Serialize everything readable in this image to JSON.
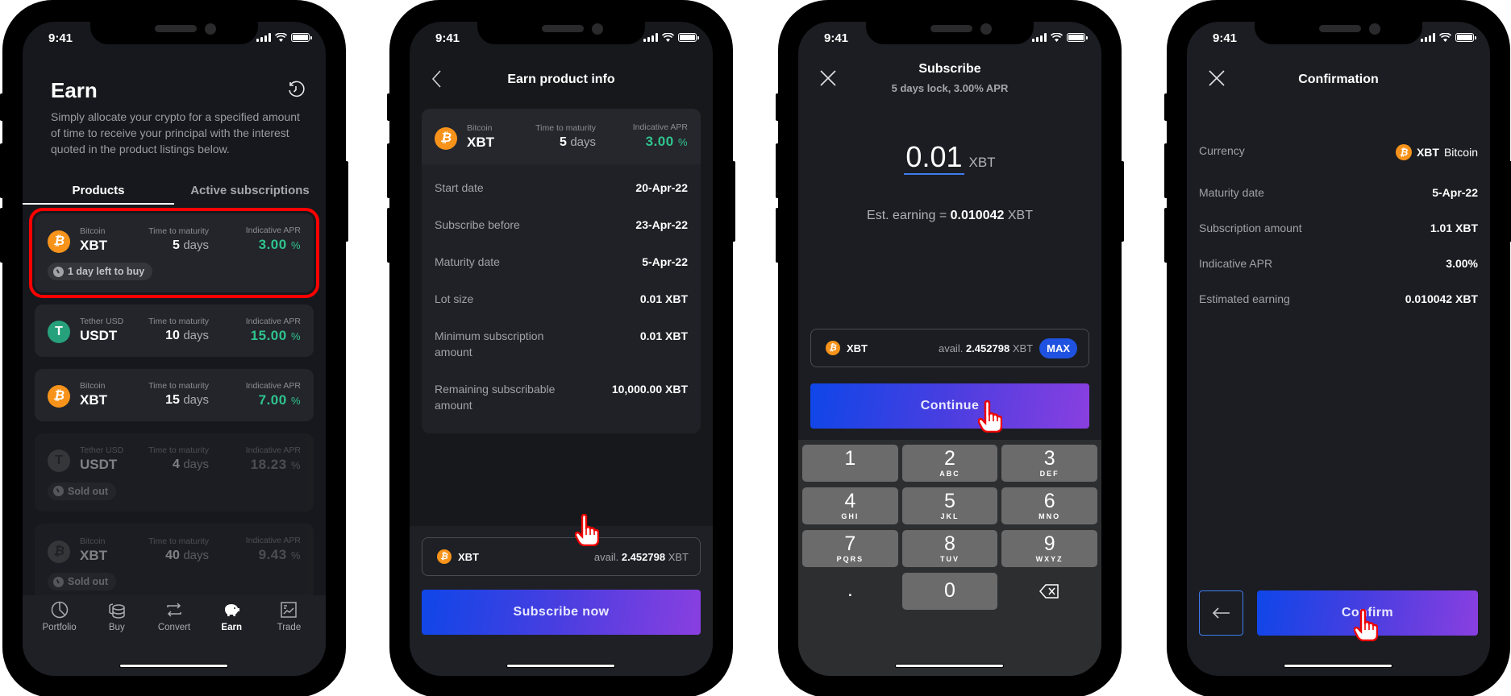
{
  "status_bar": {
    "time": "9:41"
  },
  "screen1": {
    "title": "Earn",
    "description": "Simply allocate your crypto for a specified amount of time to receive your principal with the interest quoted in the product listings below.",
    "tabs": [
      {
        "label": "Products",
        "active": true
      },
      {
        "label": "Active subscriptions",
        "active": false
      }
    ],
    "maturity_label": "Time to maturity",
    "apr_label": "Indicative APR",
    "days_unit": "days",
    "percent_unit": "%",
    "products": [
      {
        "coin_name": "Bitcoin",
        "ticker": "XBT",
        "coin": "btc",
        "days": "5",
        "apr": "3.00",
        "badge": "1 day left to buy",
        "status": "selected"
      },
      {
        "coin_name": "Tether USD",
        "ticker": "USDT",
        "coin": "usdt",
        "days": "10",
        "apr": "15.00",
        "badge": null,
        "status": "available"
      },
      {
        "coin_name": "Bitcoin",
        "ticker": "XBT",
        "coin": "btc",
        "days": "15",
        "apr": "7.00",
        "badge": null,
        "status": "available"
      },
      {
        "coin_name": "Tether USD",
        "ticker": "USDT",
        "coin": "usdt",
        "days": "4",
        "apr": "18.23",
        "badge": "Sold out",
        "status": "sold-out"
      },
      {
        "coin_name": "Bitcoin",
        "ticker": "XBT",
        "coin": "btc",
        "days": "40",
        "apr": "9.43",
        "badge": "Sold out",
        "status": "sold-out"
      }
    ],
    "nav": [
      {
        "label": "Portfolio",
        "icon": "pie-chart-icon",
        "active": false
      },
      {
        "label": "Buy",
        "icon": "coins-stack-icon",
        "active": false
      },
      {
        "label": "Convert",
        "icon": "swap-arrows-icon",
        "active": false
      },
      {
        "label": "Earn",
        "icon": "piggy-bank-icon",
        "active": true
      },
      {
        "label": "Trade",
        "icon": "trade-chart-icon",
        "active": false
      }
    ]
  },
  "screen2": {
    "title": "Earn product info",
    "product": {
      "coin_name": "Bitcoin",
      "ticker": "XBT",
      "maturity_label": "Time to maturity",
      "days": "5",
      "days_unit": "days",
      "apr_label": "Indicative APR",
      "apr": "3.00",
      "percent_unit": "%"
    },
    "rows": [
      {
        "label": "Start date",
        "value": "20-Apr-22"
      },
      {
        "label": "Subscribe before",
        "value": "23-Apr-22"
      },
      {
        "label": "Maturity date",
        "value": "5-Apr-22"
      },
      {
        "label": "Lot size",
        "value": "0.01 XBT"
      },
      {
        "label": "Minimum subscription amount",
        "value": "0.01 XBT"
      },
      {
        "label": "Remaining subscribable amount",
        "value": "10,000.00 XBT"
      }
    ],
    "balance": {
      "ticker": "XBT",
      "avail_label": "avail.",
      "amount": "2.452798",
      "unit": "XBT"
    },
    "cta": "Subscribe now"
  },
  "screen3": {
    "title": "Subscribe",
    "subtitle": "5 days lock, 3.00% APR",
    "amount": "0.01",
    "amount_unit": "XBT",
    "est_label": "Est. earning =",
    "est_value": "0.010042",
    "est_unit": "XBT",
    "balance": {
      "ticker": "XBT",
      "avail_label": "avail.",
      "amount": "2.452798",
      "unit": "XBT",
      "max_label": "MAX"
    },
    "cta": "Continue",
    "keypad": [
      [
        {
          "d": "1",
          "l": ""
        },
        {
          "d": "2",
          "l": "ABC"
        },
        {
          "d": "3",
          "l": "DEF"
        }
      ],
      [
        {
          "d": "4",
          "l": "GHI"
        },
        {
          "d": "5",
          "l": "JKL"
        },
        {
          "d": "6",
          "l": "MNO"
        }
      ],
      [
        {
          "d": "7",
          "l": "PQRS"
        },
        {
          "d": "8",
          "l": "TUV"
        },
        {
          "d": "9",
          "l": "WXYZ"
        }
      ]
    ],
    "keypad_last_row": {
      "dot": ".",
      "zero": "0"
    }
  },
  "screen4": {
    "title": "Confirmation",
    "rows": [
      {
        "label": "Currency",
        "ticker": "XBT",
        "value": "Bitcoin"
      },
      {
        "label": "Maturity date",
        "value": "5-Apr-22"
      },
      {
        "label": "Subscription amount",
        "value": "1.01 XBT"
      },
      {
        "label": "Indicative APR",
        "value": "3.00%"
      },
      {
        "label": "Estimated earning",
        "value": "0.010042 XBT"
      }
    ],
    "cta": "Confirm"
  },
  "colors": {
    "accent_green": "#2fc48d",
    "bitcoin_orange": "#f7931a",
    "tether_green": "#26a17b",
    "gradient_start": "#0f46e8",
    "gradient_end": "#8a3fe0",
    "highlight_red": "#ff0000"
  }
}
